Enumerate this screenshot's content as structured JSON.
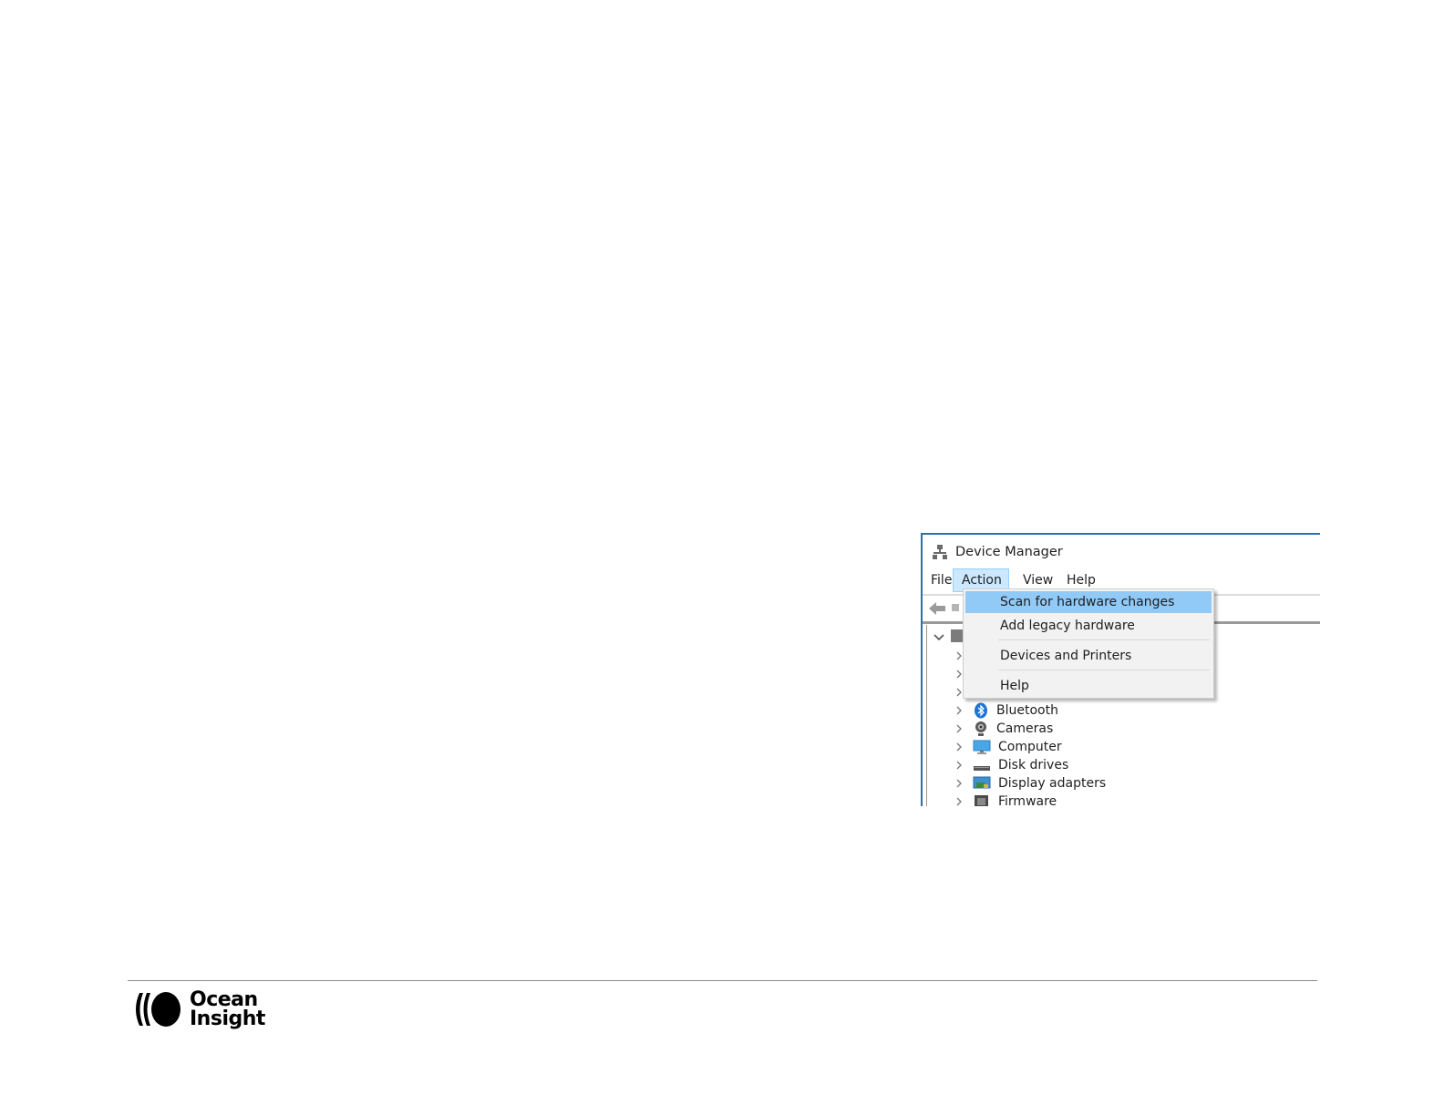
{
  "device_manager": {
    "title": "Device Manager",
    "menu": [
      "File",
      "Action",
      "View",
      "Help"
    ],
    "active_menu": "Action",
    "context_menu": {
      "items": [
        {
          "label": "Scan for hardware changes",
          "highlighted": true
        },
        {
          "label": "Add legacy hardware",
          "highlighted": false
        },
        {
          "label": "Devices and Printers",
          "highlighted": false
        },
        {
          "label": "Help",
          "highlighted": false
        }
      ]
    },
    "tree": [
      {
        "label": "Bluetooth",
        "icon": "bluetooth-icon"
      },
      {
        "label": "Cameras",
        "icon": "camera-icon"
      },
      {
        "label": "Computer",
        "icon": "monitor-icon"
      },
      {
        "label": "Disk drives",
        "icon": "disk-drive-icon"
      },
      {
        "label": "Display adapters",
        "icon": "display-adapter-icon"
      },
      {
        "label": "Firmware",
        "icon": "firmware-icon"
      }
    ]
  },
  "footer": {
    "logo_line1": "Ocean",
    "logo_line2": "Insight"
  },
  "colors": {
    "highlight": "#91c9f7",
    "active_menu_bg": "#cce8ff",
    "window_border": "#2f6fa7"
  }
}
